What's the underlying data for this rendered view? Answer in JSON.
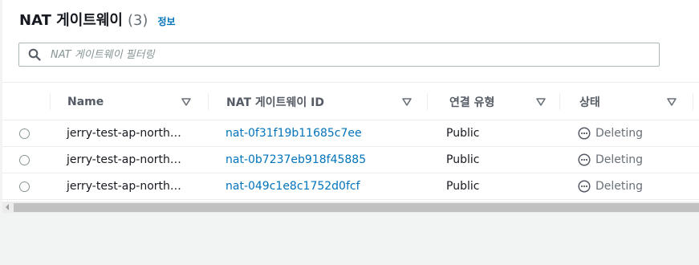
{
  "header": {
    "title": "NAT 게이트웨이",
    "count": "(3)",
    "info_link": "정보"
  },
  "search": {
    "placeholder": "NAT 게이트웨이 필터링",
    "icon": "search-icon"
  },
  "columns": [
    {
      "label": "Name"
    },
    {
      "label": "NAT 게이트웨이 ID"
    },
    {
      "label": "연결 유형"
    },
    {
      "label": "상태"
    }
  ],
  "rows": [
    {
      "name": "jerry-test-ap-north…",
      "id": "nat-0f31f19b11685c7ee",
      "type": "Public",
      "status": "Deleting"
    },
    {
      "name": "jerry-test-ap-north…",
      "id": "nat-0b7237eb918f45885",
      "type": "Public",
      "status": "Deleting"
    },
    {
      "name": "jerry-test-ap-north…",
      "id": "nat-049c1e8c1752d0fcf",
      "type": "Public",
      "status": "Deleting"
    }
  ],
  "colors": {
    "link": "#0073bb",
    "status_text": "#687078",
    "header_text": "#545b64"
  }
}
